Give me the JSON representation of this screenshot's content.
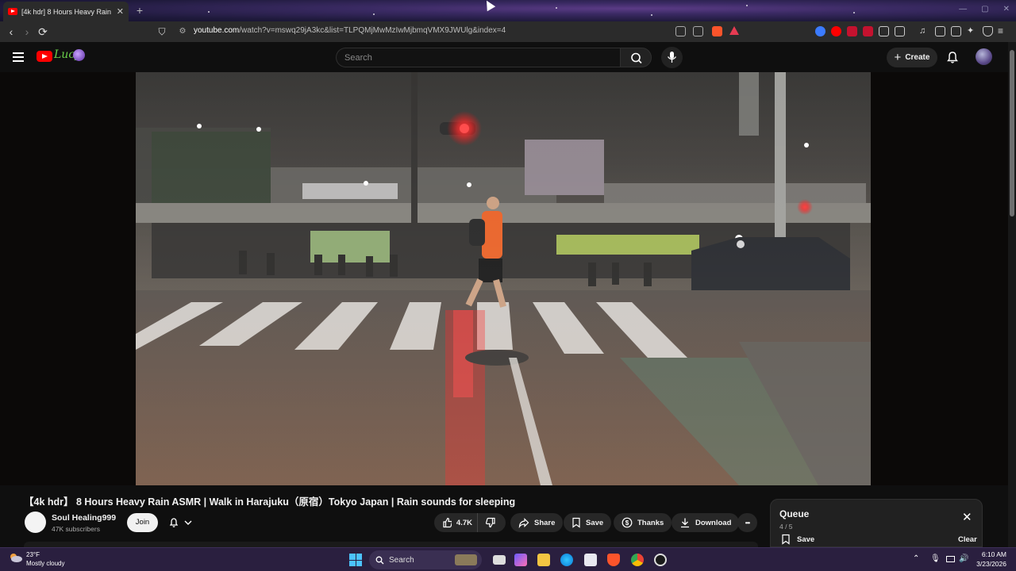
{
  "browser": {
    "tab_title": "[4k hdr] 8 Hours Heavy Rain",
    "tab_close": "✕",
    "new_tab": "+",
    "url_host": "youtube.com",
    "url_rest": "/watch?v=mswq29jA3kc&list=TLPQMjMwMzIwMjbmqVMX9JWUlg&index=4"
  },
  "header": {
    "search_placeholder": "Search",
    "create_label": "Create"
  },
  "video": {
    "title": "【4k hdr】 8 Hours Heavy Rain ASMR | Walk in Harajuku（原宿）Tokyo Japan | Rain sounds for sleeping",
    "channel_name": "Soul Healing999",
    "subscribers": "47K subscribers",
    "join_label": "Join",
    "likes": "4.7K",
    "share_label": "Share",
    "save_label": "Save",
    "thanks_label": "Thanks",
    "download_label": "Download",
    "more_label": "•••"
  },
  "queue": {
    "title": "Queue",
    "count": "4 / 5",
    "save_label": "Save",
    "clear_label": "Clear",
    "close": "✕"
  },
  "taskbar": {
    "temperature": "23°F",
    "weather": "Mostly cloudy",
    "search_label": "Search",
    "time": "6:10 AM",
    "date": "3/23/2026"
  },
  "colors": {
    "accent_red": "#ff0000",
    "background": "#0f0f0f",
    "taskbar": "#2a1f3f"
  }
}
